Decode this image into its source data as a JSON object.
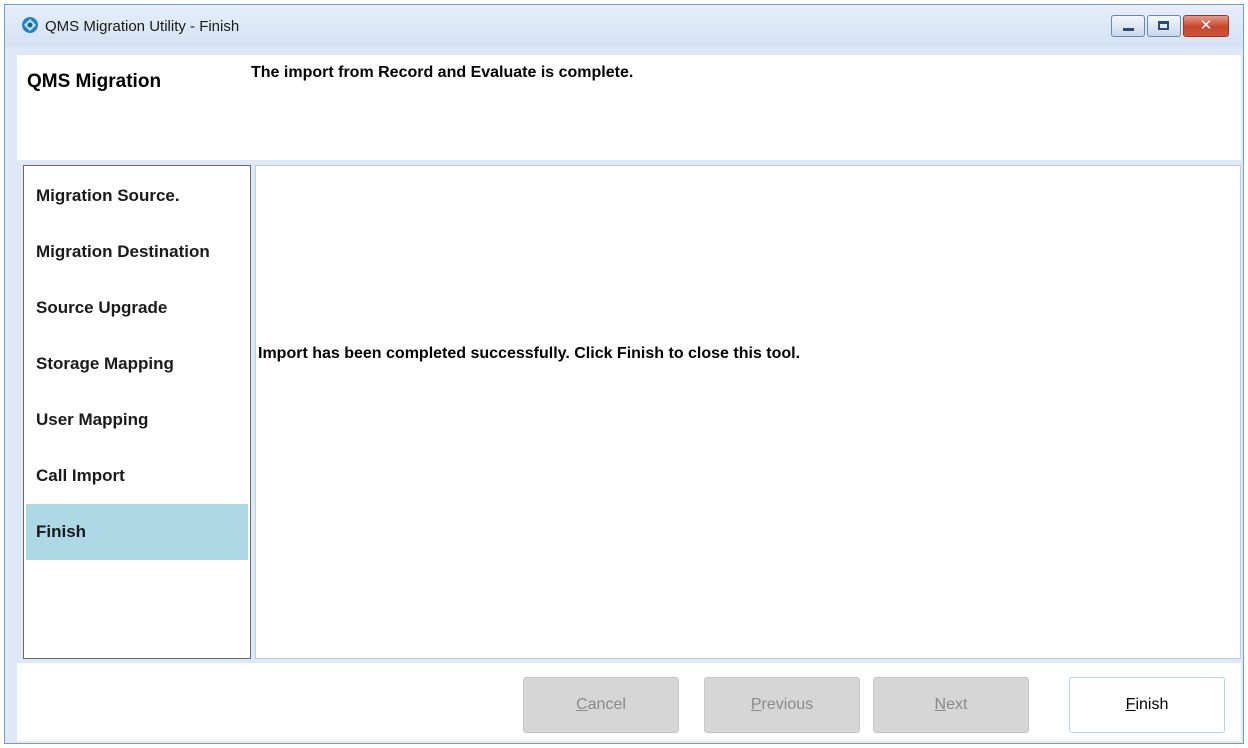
{
  "window": {
    "title": "QMS Migration Utility - Finish",
    "close_glyph": "✕"
  },
  "header": {
    "title": "QMS Migration",
    "message": "The import from Record and Evaluate is complete."
  },
  "steps": [
    {
      "label": "Migration Source."
    },
    {
      "label": "Migration Destination"
    },
    {
      "label": "Source Upgrade"
    },
    {
      "label": "Storage Mapping"
    },
    {
      "label": "User Mapping"
    },
    {
      "label": "Call Import"
    },
    {
      "label": "Finish",
      "active": true
    }
  ],
  "content": {
    "message": "Import has been completed successfully. Click Finish to close this tool."
  },
  "buttons": {
    "cancel": {
      "mnemonic": "C",
      "rest": "ancel",
      "enabled": false
    },
    "previous": {
      "mnemonic": "P",
      "rest": "revious",
      "enabled": false
    },
    "next": {
      "mnemonic": "N",
      "rest": "ext",
      "enabled": false
    },
    "finish": {
      "mnemonic": "F",
      "rest": "inish",
      "enabled": true
    }
  },
  "colors": {
    "active_step": "#add8e6",
    "window_frame": "#dde9f7",
    "disabled_button": "#d6d6d6"
  },
  "icons": {
    "app": "qms-logo-icon"
  }
}
